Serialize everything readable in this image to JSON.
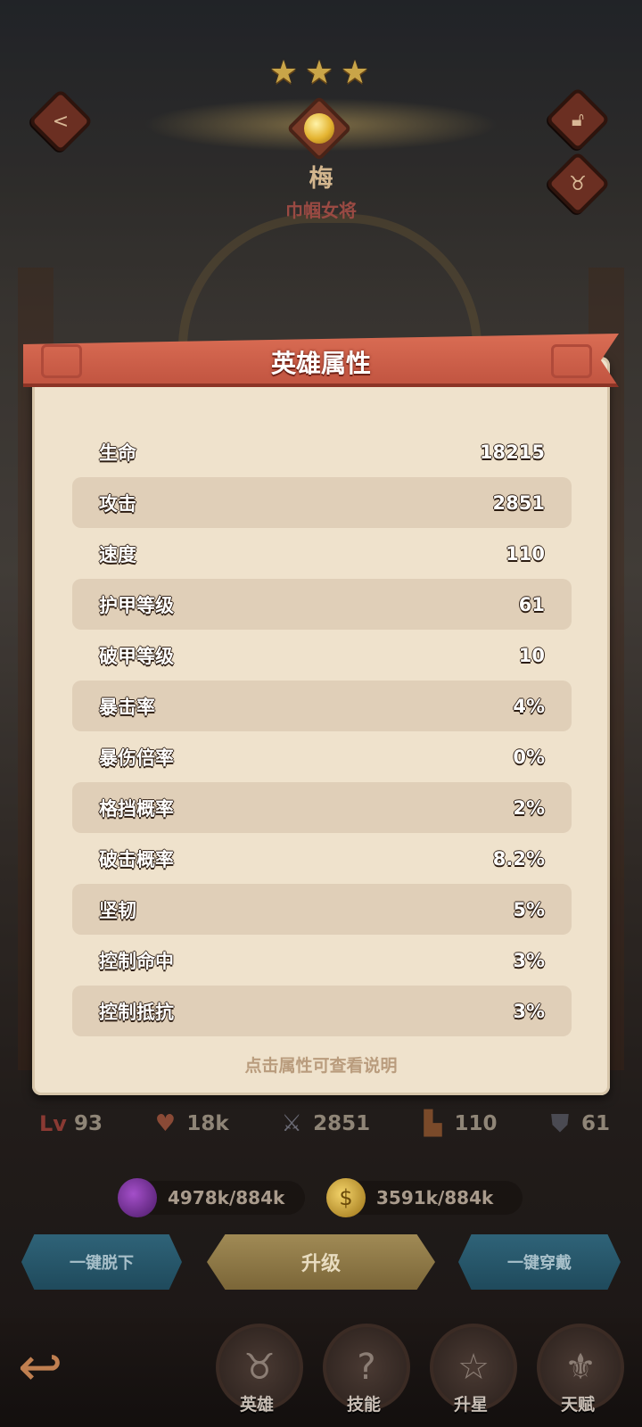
{
  "hero": {
    "name": "梅",
    "title": "巾帼女将",
    "stars": 3
  },
  "panel": {
    "title": "英雄属性",
    "hint": "点击属性可查看说明",
    "stats": [
      {
        "label": "生命",
        "value": "18215"
      },
      {
        "label": "攻击",
        "value": "2851"
      },
      {
        "label": "速度",
        "value": "110"
      },
      {
        "label": "护甲等级",
        "value": "61"
      },
      {
        "label": "破甲等级",
        "value": "10"
      },
      {
        "label": "暴击率",
        "value": "4%"
      },
      {
        "label": "暴伤倍率",
        "value": "0%"
      },
      {
        "label": "格挡概率",
        "value": "2%"
      },
      {
        "label": "破击概率",
        "value": "8.2%"
      },
      {
        "label": "坚韧",
        "value": "5%"
      },
      {
        "label": "控制命中",
        "value": "3%"
      },
      {
        "label": "控制抵抗",
        "value": "3%"
      }
    ]
  },
  "summary": {
    "level_label": "Lv",
    "level": "93",
    "hp": "18k",
    "attack": "2851",
    "speed": "110",
    "armor": "61"
  },
  "resources": {
    "potion": "4978k/884k",
    "gold": "3591k/884k"
  },
  "actions": {
    "unequip_all": "一键脱下",
    "upgrade": "升级",
    "equip_all": "一键穿戴"
  },
  "nav": {
    "hero": "英雄",
    "skill": "技能",
    "star_up": "升星",
    "talent": "天赋"
  },
  "colors": {
    "panel_bg": "#efe2cc",
    "banner": "#c8594a",
    "row_shade": "#e0cfb8"
  }
}
